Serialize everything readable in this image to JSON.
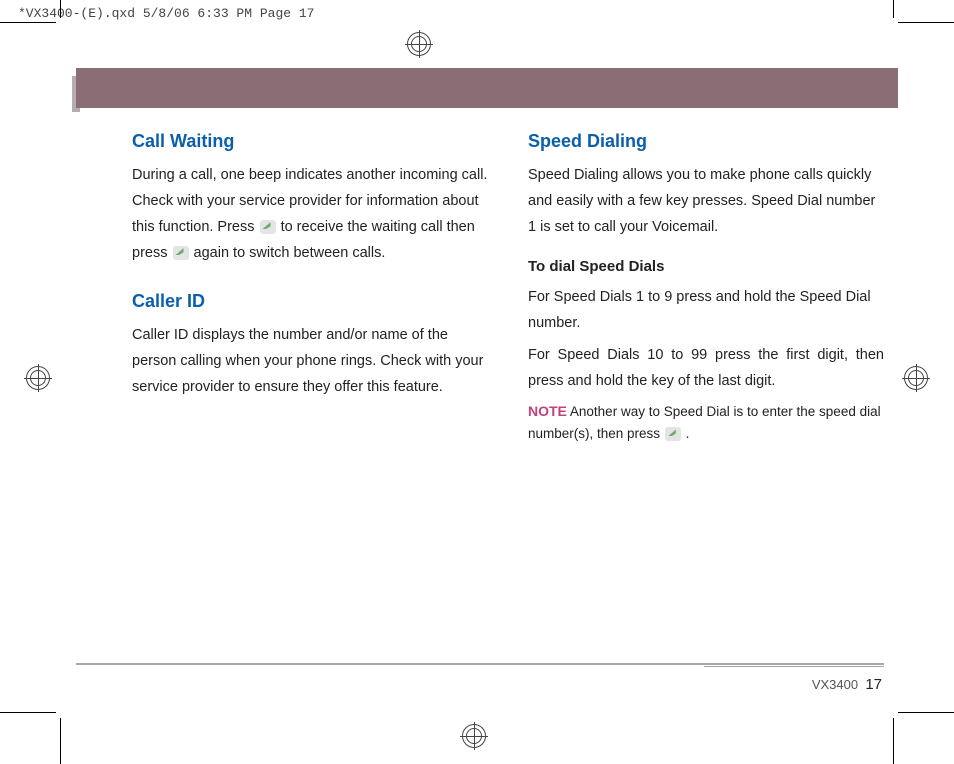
{
  "header_line": "*VX3400-(E).qxd  5/8/06  6:33 PM  Page 17",
  "left": {
    "h1": "Call Waiting",
    "p1a": "During a call, one beep indicates another incoming call. Check with your service provider for information about this function. Press ",
    "p1b": " to receive the waiting call then press ",
    "p1c": " again to switch between calls.",
    "h2": "Caller ID",
    "p2": "Caller ID displays the number and/or name of the person calling when your phone rings. Check with your service provider to ensure they offer this feature."
  },
  "right": {
    "h1": "Speed Dialing",
    "p1": "Speed Dialing allows you to make phone calls quickly and easily with a few key presses. Speed Dial number 1 is set to call your Voicemail.",
    "sub": "To dial Speed Dials",
    "p2": "For Speed Dials 1 to 9 press and hold the Speed Dial number.",
    "p3": "For Speed Dials 10 to 99 press the first digit, then press and hold the key of the last digit.",
    "note_label": "NOTE",
    "note_a": " Another way to Speed Dial is to enter the speed dial number(s), then press ",
    "note_b": " ."
  },
  "footer": {
    "model": "VX3400",
    "page": "17"
  }
}
